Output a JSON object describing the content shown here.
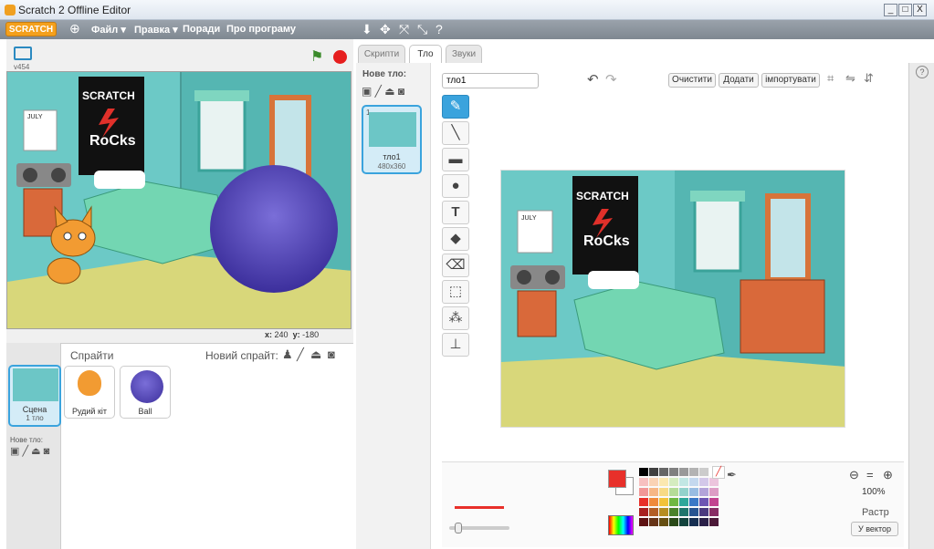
{
  "window": {
    "title": "Scratch 2 Offline Editor",
    "min": "_",
    "max": "□",
    "close": "X"
  },
  "menubar": {
    "logo": "SCRATCH",
    "items": [
      "Файл ▾",
      "Правка ▾",
      "Поради",
      "Про програму"
    ]
  },
  "stage": {
    "version": "v454",
    "x_label": "x:",
    "x_value": "240",
    "y_label": "y:",
    "y_value": "-180",
    "poster_line1": "SCRATCH",
    "poster_line2": "RoCks",
    "calendar_label": "JULY"
  },
  "sprites": {
    "header": "Спрайти",
    "new_sprite_label": "Новий спрайт:",
    "scene_label": "Сцена",
    "scene_sub": "1 тло",
    "new_backdrop_label": "Нове тло:",
    "items": [
      {
        "name": "Рудий кіт"
      },
      {
        "name": "Ball"
      }
    ]
  },
  "tabs": [
    "Скрипти",
    "Тло",
    "Звуки"
  ],
  "backdrops": {
    "new_label": "Нове тло:",
    "items": [
      {
        "index": "1",
        "name": "тло1",
        "size": "480x360"
      }
    ]
  },
  "editor": {
    "name_value": "тло1",
    "clear_button": "Очистити",
    "add_button": "Додати",
    "import_button": "імпортувати",
    "canvas_poster_line1": "SCRATCH",
    "canvas_poster_line2": "RoCks",
    "canvas_calendar": "JULY",
    "zoom_level": "100%",
    "mode_label": "Растр",
    "convert_button": "У вектор",
    "primary_color": "#e8302a",
    "secondary_color": "#ffffff"
  },
  "colors": {
    "accent_blue": "#3aa3dd",
    "palette": [
      [
        "#000000",
        "#404040",
        "#666666",
        "#808080",
        "#999999",
        "#b3b3b3",
        "#cccccc",
        "#ffffff"
      ],
      [
        "#f7c0c0",
        "#fad3b5",
        "#fbe8b0",
        "#d5ecc0",
        "#c2e7e4",
        "#c4d8ee",
        "#d3c8e9",
        "#ecc5dd"
      ],
      [
        "#f19797",
        "#f6b786",
        "#f7da85",
        "#b5dc98",
        "#93d2cc",
        "#98bce2",
        "#b3a3d9",
        "#dd9dc5"
      ],
      [
        "#e8302a",
        "#ef8a3c",
        "#f2c23a",
        "#6fb842",
        "#2fa79a",
        "#3a78c6",
        "#6e55b3",
        "#c2438f"
      ],
      [
        "#a82020",
        "#b25e25",
        "#b58d22",
        "#4a822a",
        "#1f756c",
        "#275491",
        "#4b397f",
        "#882c64"
      ],
      [
        "#5e1212",
        "#663417",
        "#664f12",
        "#2a4a18",
        "#12433d",
        "#162f52",
        "#2a2048",
        "#4c1938"
      ]
    ]
  }
}
